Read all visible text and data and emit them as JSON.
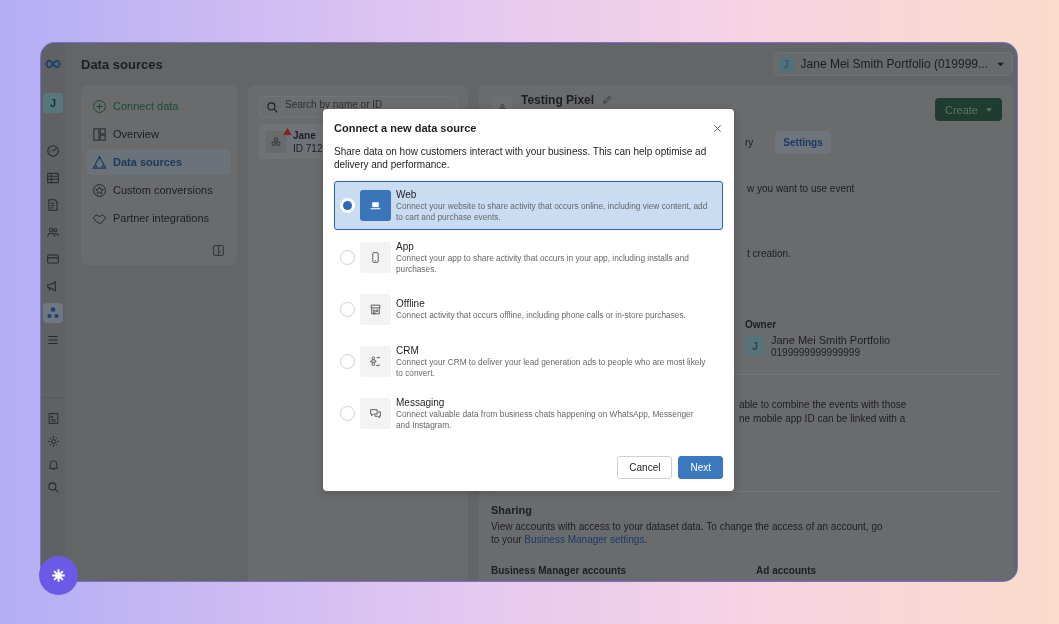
{
  "rail": {
    "avatar": "J",
    "items": [
      {
        "selected": false
      },
      {
        "selected": false
      },
      {
        "selected": false
      },
      {
        "selected": false
      },
      {
        "selected": false
      },
      {
        "selected": false
      },
      {
        "selected": true
      },
      {
        "selected": false
      }
    ]
  },
  "page_title": "Data sources",
  "portfolio": {
    "avatar": "J",
    "name": "Jane Mei Smith Portfolio (019999..."
  },
  "nav": {
    "items": [
      {
        "label": "Connect data",
        "kind": "action",
        "selected": false
      },
      {
        "label": "Overview",
        "kind": "link",
        "selected": false
      },
      {
        "label": "Data sources",
        "kind": "link",
        "selected": true
      },
      {
        "label": "Custom conversions",
        "kind": "link",
        "selected": false
      },
      {
        "label": "Partner integrations",
        "kind": "link",
        "selected": false
      }
    ]
  },
  "source_list": {
    "search": {
      "placeholder": "Search by name or ID"
    },
    "items": [
      {
        "title": "Jane",
        "subtitle": "ID 712",
        "warning": true,
        "selected": true
      }
    ]
  },
  "detail": {
    "title": "Testing Pixel",
    "create_button": "Create",
    "tabs": [
      {
        "label": "ry",
        "selected": false
      },
      {
        "label": "Settings",
        "selected": true
      }
    ],
    "fragments": [
      "w you want to use event",
      "t creation."
    ],
    "owner": {
      "heading": "Owner",
      "avatar": "J",
      "name": "Jane Mei Smith Portfolio",
      "id": "0199999999999999"
    },
    "linking_lines": [
      "able to combine the events with those",
      "ne mobile app ID can be linked with a"
    ],
    "sharing": {
      "heading": "Sharing",
      "text": "View accounts with access to your dataset data. To change the access of an account, go to your ",
      "link": "Business Manager settings",
      "after": "."
    },
    "columns": [
      "Business Manager accounts",
      "Ad accounts"
    ]
  },
  "modal": {
    "title": "Connect a new data source",
    "description": "Share data on how customers interact with your business. This can help optimise ad delivery and performance.",
    "options": [
      {
        "kind": "web",
        "title": "Web",
        "description": "Connect your website to share activity that occurs online, including view content, add to cart and purchase events.",
        "selected": true
      },
      {
        "kind": "app",
        "title": "App",
        "description": "Connect your app to share activity that occurs in your app, including installs and purchases.",
        "selected": false
      },
      {
        "kind": "offline",
        "title": "Offline",
        "description": "Connect activity that occurs offline, including phone calls or in-store purchases.",
        "selected": false
      },
      {
        "kind": "crm",
        "title": "CRM",
        "description": "Connect your CRM to deliver your lead generation ads to people who are most likely to convert.",
        "selected": false
      },
      {
        "kind": "messaging",
        "title": "Messaging",
        "description": "Connect valuable data from business chats happening on WhatsApp, Messenger and Instagram.",
        "selected": false
      }
    ],
    "cancel": "Cancel",
    "next": "Next"
  }
}
